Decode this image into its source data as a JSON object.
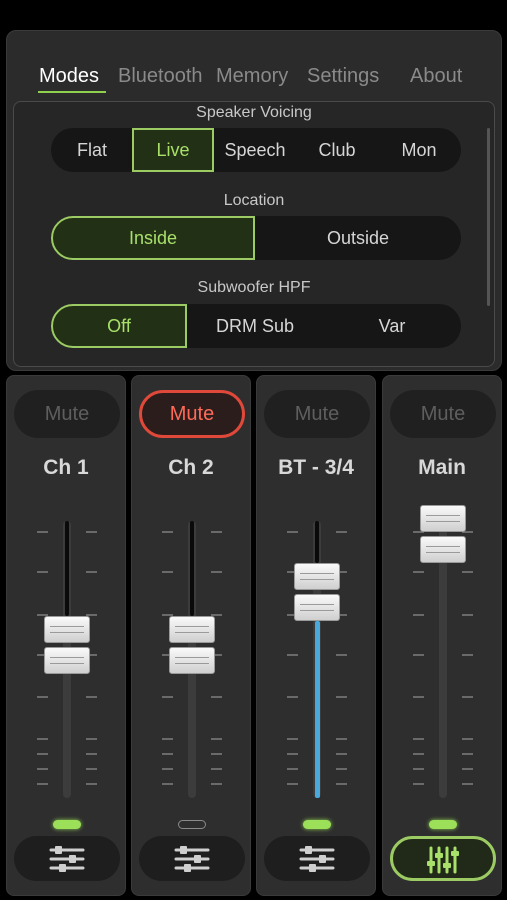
{
  "tabs": [
    "Modes",
    "Bluetooth",
    "Memory",
    "Settings",
    "About"
  ],
  "active_tab": "Modes",
  "speaker_voicing": {
    "title": "Speaker Voicing",
    "options": [
      "Flat",
      "Live",
      "Speech",
      "Club",
      "Mon"
    ],
    "selected": "Live"
  },
  "location": {
    "title": "Location",
    "options": [
      "Inside",
      "Outside"
    ],
    "selected": "Inside"
  },
  "subwoofer_hpf": {
    "title": "Subwoofer HPF",
    "options": [
      "Off",
      "DRM Sub",
      "Var"
    ],
    "selected": "Off"
  },
  "channels": [
    {
      "name": "Ch 1",
      "mute_label": "Mute",
      "muted": false,
      "fader_level": 0.55,
      "signal": "on",
      "eq_icon": "sliders-icon"
    },
    {
      "name": "Ch 2",
      "mute_label": "Mute",
      "muted": true,
      "fader_level": 0.55,
      "signal": "off",
      "eq_icon": "sliders-icon"
    },
    {
      "name": "BT - 3/4",
      "mute_label": "Mute",
      "muted": false,
      "fader_level": 0.74,
      "signal": "on",
      "eq_icon": "sliders-icon"
    },
    {
      "name": "Main",
      "mute_label": "Mute",
      "muted": false,
      "fader_level": 0.95,
      "signal": "on",
      "eq_icon": "vertical-sliders-icon",
      "eq_active": true
    }
  ],
  "colors": {
    "accent_green": "#9ccb63",
    "mute_red": "#e0493a",
    "fader_fill_blue": "#49a8dc"
  }
}
